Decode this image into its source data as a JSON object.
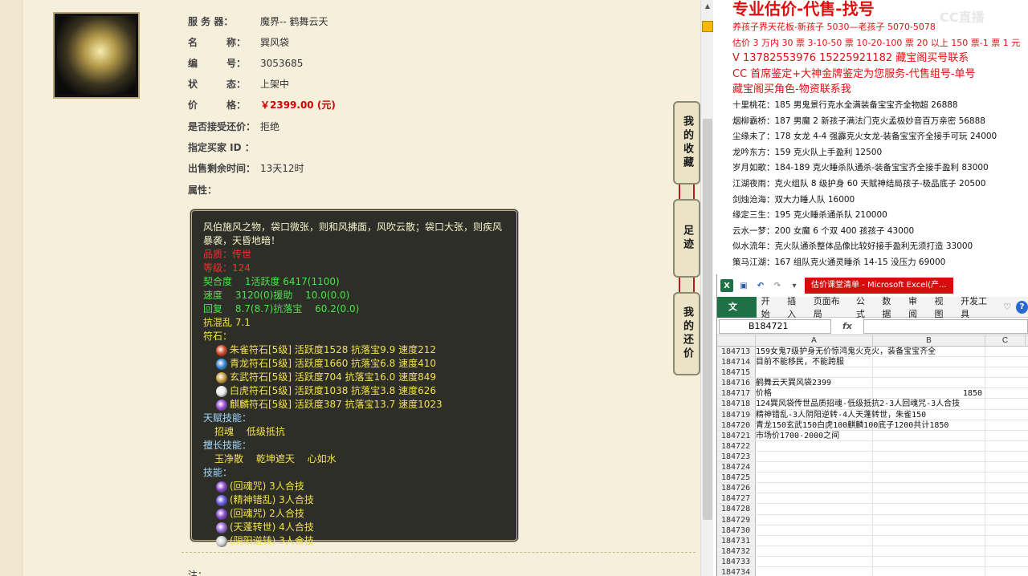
{
  "item": {
    "server_label": "服 务 器：",
    "server_value": "魔界-- 鹤舞云天",
    "name_label": "名　　　称：",
    "name_value": "巽风袋",
    "id_label": "编　　　号：",
    "id_value": "3053685",
    "status_label": "状　　　态：",
    "status_value": "上架中",
    "price_label": "价　　　格：",
    "price_value": "￥2399.00 (元)",
    "bargain_label": "是否接受还价：",
    "bargain_value": "拒绝",
    "buyer_label": "指定买家 ID ：",
    "time_label": "出售剩余时间：",
    "time_value": "13天12时",
    "attr_label": "属性："
  },
  "attributes": {
    "description": "风伯施风之物，袋口微张，则和风拂面，风吹云散；袋口大张，则疾风暴袭，天昏地暗！",
    "quality": "品质：传世",
    "level": "等级：124",
    "line_qihe": "契合度　 1活跃度  6417(1100)",
    "line_speed": "速度　 3120(0)援助　 10.0(0.0)",
    "line_recover": "回复　 8.7(8.7)抗落宝　 60.2(0.0)",
    "line_kanghun": "抗混乱 7.1",
    "runes_label": "符石：",
    "runes": [
      "朱雀符石[5级] 活跃度1528 抗落宝9.9 速度212",
      "青龙符石[5级] 活跃度1660 抗落宝6.8 速度410",
      "玄武符石[5级] 活跃度704 抗落宝16.0 速度849",
      "白虎符石[5级] 活跃度1038 抗落宝3.8 速度626",
      "麒麟符石[5级] 活跃度387 抗落宝13.7 速度1023"
    ],
    "talent_label": "天赋技能：",
    "talents": "招魂　 低级抵抗",
    "special_label": "擅长技能：",
    "specials": "玉净散　 乾坤遮天　 心如水",
    "skill_label": "技能：",
    "skills": [
      "(回魂咒) 3人合技",
      "(精神错乱) 3人合技",
      "(回魂咒) 2人合技",
      "(天蓬转世) 4人合技",
      "(阴阳逆转) 3人合技"
    ],
    "rune_colors": [
      "#d84a2a",
      "#3a8ad8",
      "#c8a040",
      "#e8e8e8",
      "#a050d8"
    ],
    "skill_colors": [
      "#8a4ad0",
      "#6a5ae0",
      "#8a4ad0",
      "#9a6ad8",
      "#cfcfcf"
    ]
  },
  "side_tabs": {
    "favorites": "我的收藏",
    "footprints": "足迹",
    "bargain": "我的还价"
  },
  "page": {
    "note_label": "注："
  },
  "ad": {
    "title": "专业估价-代售-找号",
    "watermark": "CC直播",
    "lines": [
      "养孩子界天花板-新孩子 5030—老孩子 5070-5078",
      "估价 3 万内 30 票  3-10-50 票  10-20-100 票 20 以上 150 票-1 票 1 元",
      "V 13782553976    15225921182   藏宝阁买号联系",
      "CC 首席鉴定+大神金牌鉴定为您服务-代售组号-单号",
      "藏宝阁买角色-物资联系我"
    ],
    "listings": [
      "十里桃花：185 男鬼景行克水全满装备宝宝齐全物超 26888",
      "烟柳霸桥：187 男魔 2 新孩子满法门克火孟极妙音百万亲密 56888",
      "尘缘未了：178 女龙 4-4 强霹克火女龙-装备宝宝齐全接手可玩 24000",
      "龙吟东方：159 克火队上手盈利 12500",
      "岁月如歌：184-189 克火睡杀队通杀-装备宝宝齐全接手盈利 83000",
      "江湖夜雨：克火组队 8 级护身 60 天赋神结局孩子-极品底子 20500",
      "剑烛沧海：双大力睡人队 16000",
      "缘定三生：195 克火睡杀通杀队 210000",
      "云水一梦：200 女魔 6 个双 400 孩孩子 43000",
      "似水流年：克火队通杀整体品像比较好接手盈利无须打造 33000",
      "策马江湖：167 组队克火通灵睡杀 14-15 没压力 69000"
    ]
  },
  "excel": {
    "doc_title": "估价课堂清单 - Microsoft Excel(产...",
    "file_tab": "文件",
    "tabs": [
      "开始",
      "插入",
      "页面布局",
      "公式",
      "数据",
      "审阅",
      "视图",
      "开发工具"
    ],
    "name_box": "B184721",
    "fx": "fx",
    "col_a": "A",
    "col_b": "B",
    "col_c": "C",
    "rows": [
      {
        "n": "184713",
        "a": "159女鬼7级护身无价惊鸿鬼火克火，装备宝宝齐全",
        "b": ""
      },
      {
        "n": "184714",
        "a": "目前不能移民，不能跨服",
        "b": ""
      },
      {
        "n": "184715",
        "a": "",
        "b": ""
      },
      {
        "n": "184716",
        "a": "鹤舞云天巽风袋2399",
        "b": ""
      },
      {
        "n": "184717",
        "a": "价格",
        "b": "1850"
      },
      {
        "n": "184718",
        "a": "124巽风袋传世品质招魂-低级抵抗2-3人回魂咒-3人合技",
        "b": ""
      },
      {
        "n": "184719",
        "a": "精神错乱-3人阴阳逆转-4人天蓬转世，朱雀150",
        "b": ""
      },
      {
        "n": "184720",
        "a": "青龙150玄武150白虎100麒麟100底子1200共计1850",
        "b": ""
      },
      {
        "n": "184721",
        "a": "市场价1700-2000之间",
        "b": ""
      },
      {
        "n": "184722",
        "a": "",
        "b": ""
      },
      {
        "n": "184723",
        "a": "",
        "b": ""
      },
      {
        "n": "184724",
        "a": "",
        "b": ""
      },
      {
        "n": "184725",
        "a": "",
        "b": ""
      },
      {
        "n": "184726",
        "a": "",
        "b": ""
      },
      {
        "n": "184727",
        "a": "",
        "b": ""
      },
      {
        "n": "184728",
        "a": "",
        "b": ""
      },
      {
        "n": "184729",
        "a": "",
        "b": ""
      },
      {
        "n": "184730",
        "a": "",
        "b": ""
      },
      {
        "n": "184731",
        "a": "",
        "b": ""
      },
      {
        "n": "184732",
        "a": "",
        "b": ""
      },
      {
        "n": "184733",
        "a": "",
        "b": ""
      },
      {
        "n": "184734",
        "a": "",
        "b": ""
      }
    ]
  }
}
